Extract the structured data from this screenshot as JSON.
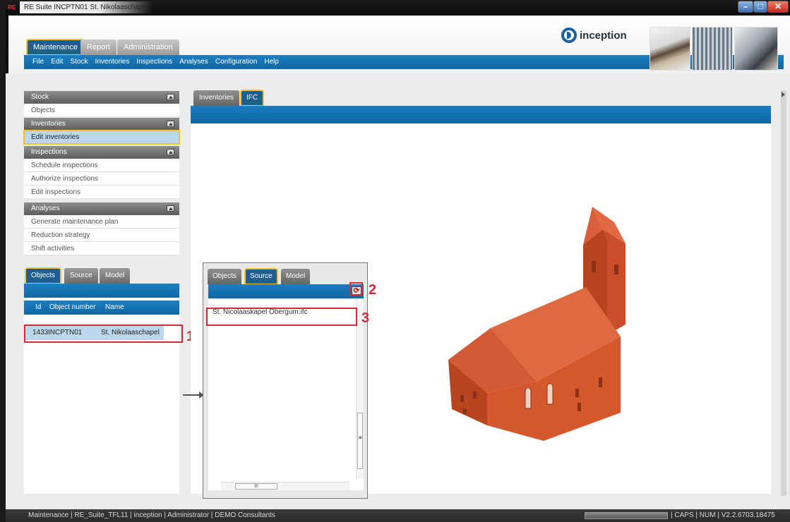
{
  "window": {
    "app_icon_text": "RE",
    "title": "RE Suite  INCPTN01  St. Nikolaaschapel",
    "controls": [
      "minimize",
      "maximize",
      "close"
    ]
  },
  "header": {
    "module_tabs": [
      {
        "label": "Maintenance",
        "active": true
      },
      {
        "label": "Report",
        "active": false
      },
      {
        "label": "Administration",
        "active": false
      }
    ],
    "menu": [
      "File",
      "Edit",
      "Stock",
      "Inventories",
      "Inspections",
      "Analyses",
      "Configuration",
      "Help"
    ],
    "logo_text": "inception"
  },
  "sidebar": {
    "sections": [
      {
        "title": "Stock",
        "items": [
          "Objects"
        ]
      },
      {
        "title": "Inventories",
        "items": [
          "Edit inventories"
        ]
      },
      {
        "title": "Inspections",
        "items": [
          "Schedule inspections",
          "Authorize inspections",
          "Edit inspections"
        ]
      },
      {
        "title": "Analyses",
        "items": [
          "Generate maintenance plan",
          "Reduction strategy",
          "Shift activities"
        ]
      }
    ],
    "selected_item": "Edit inventories"
  },
  "object_panel": {
    "tabs": [
      "Objects",
      "Source",
      "Model"
    ],
    "active_tab": "Objects",
    "columns": [
      "Id",
      "Object number",
      "Name"
    ],
    "rows": [
      {
        "id": "1433",
        "object_number": "INCPTN01",
        "name": "St. Nikolaaschapel"
      }
    ]
  },
  "viewer": {
    "tabs": [
      "Inventories",
      "IFC"
    ],
    "active_tab": "IFC"
  },
  "popup": {
    "tabs": [
      "Objects",
      "Source",
      "Model"
    ],
    "active_tab": "Source",
    "files": [
      "St. Nicolaaskapel Obergum.ifc"
    ],
    "refresh_icon": "refresh-icon",
    "hscroll_thumb_text": "III",
    "vscroll_thumb_text": "≡"
  },
  "callouts": [
    "1",
    "2",
    "3"
  ],
  "status": {
    "left": "Maintenance | RE_Suite_TFL11 | inception | Administrator | DEMO Consultants",
    "right": "| CAPS | NUM | V2.2.6703.18475"
  },
  "colors": {
    "accent_blue": "#1b7fc0",
    "highlight_yellow": "#f0c430",
    "callout_red": "#d9283a",
    "model_orange": "#d8552e"
  }
}
